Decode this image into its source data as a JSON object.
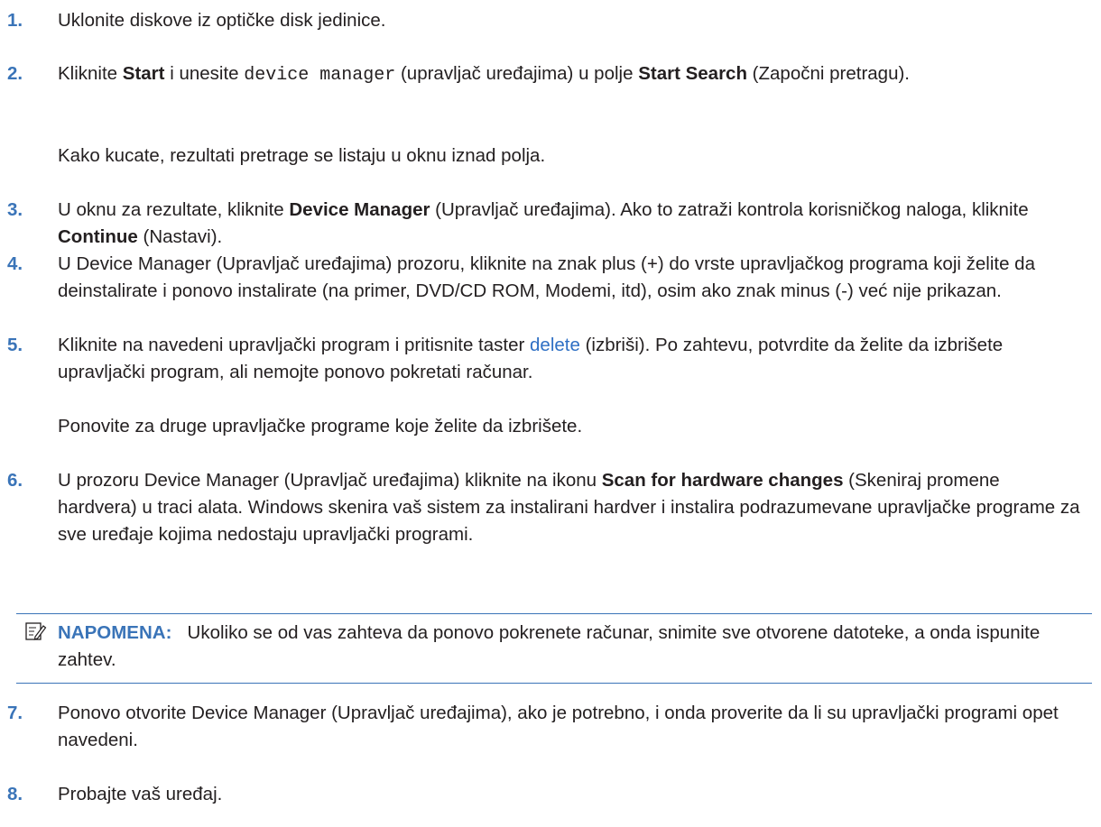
{
  "steps": [
    {
      "num": "1.",
      "text": "Uklonite diskove iz optičke disk jedinice."
    },
    {
      "num": "2.",
      "t1": "Kliknite ",
      "b1": "Start",
      "t2": " i unesite ",
      "code": "device manager",
      "t3": " (upravljač uređajima) u polje ",
      "b2": "Start Search",
      "t4": " (Započni pretragu).",
      "sub": "Kako kucate, rezultati pretrage se listaju u oknu iznad polja."
    },
    {
      "num": "3.",
      "t1": "U oknu za rezultate, kliknite ",
      "b1": "Device Manager",
      "t2": " (Upravljač uređajima). Ako to zatraži kontrola korisničkog naloga, kliknite ",
      "b2": "Continue",
      "t3": " (Nastavi)."
    },
    {
      "num": "4.",
      "text": "U Device Manager (Upravljač uređajima) prozoru, kliknite na znak plus (+) do vrste upravljačkog programa koji želite da deinstalirate i ponovo instalirate (na primer, DVD/CD ROM, Modemi, itd), osim ako znak minus (-) već nije prikazan."
    },
    {
      "num": "5.",
      "t1": "Kliknite na navedeni upravljački program i pritisnite taster ",
      "link": "delete",
      "t2": " (izbriši). Po zahtevu, potvrdite da želite da izbrišete upravljački program, ali nemojte ponovo pokretati računar.",
      "sub": "Ponovite za druge upravljačke programe koje želite da izbrišete."
    },
    {
      "num": "6.",
      "t1": "U prozoru Device Manager (Upravljač uređajima) kliknite na ikonu ",
      "b1": "Scan for hardware changes",
      "t2": " (Skeniraj promene hardvera) u traci alata. Windows skenira vaš sistem za instalirani hardver i instalira podrazumevane upravljačke programe za sve uređaje kojima nedostaju upravljački programi."
    },
    {
      "num": "7.",
      "text": "Ponovo otvorite Device Manager (Upravljač uređajima), ako je potrebno, i onda proverite da li su upravljački programi opet navedeni."
    },
    {
      "num": "8.",
      "text": "Probajte vaš uređaj."
    }
  ],
  "note": {
    "label": "NAPOMENA:",
    "text": "Ukoliko se od vas zahteva da ponovo pokrenete računar, snimite sve otvorene datoteke, a onda ispunite zahtev.",
    "icon": "note-pencil-icon"
  },
  "colors": {
    "accent": "#3a74b8",
    "link": "#2e6fc4",
    "text": "#231f20"
  }
}
